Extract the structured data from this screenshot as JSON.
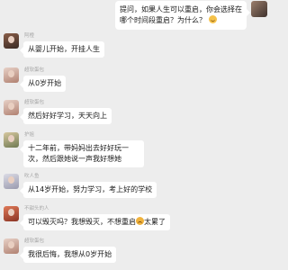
{
  "question": {
    "text": "提问，如果人生可以重启，你会选择在哪个时间段重启？为什么？"
  },
  "messages": [
    {
      "name": "阿橙",
      "text": "从婴儿开始，开挂人生",
      "avatar_color": "#6b4a3a"
    },
    {
      "name": "超软蛋包",
      "text": "从0岁开始",
      "avatar_color": "#c9a99a"
    },
    {
      "name": "超软蛋包",
      "text": "然后好好学习，天天向上",
      "avatar_color": "#c9a99a"
    },
    {
      "name": "护姐",
      "text": "十二年前，带妈妈出去好好玩一次，然后跟她说一声我好想她",
      "avatar_color": "#8a9a6a"
    },
    {
      "name": "吹人鱼",
      "text": "从14岁开始，努力学习，考上好的学校",
      "avatar_color": "#b8b8c8"
    },
    {
      "name": "不甜头的人",
      "text": "可以毁灭吗？我想毁灭，不想重启",
      "text_suffix": "太累了",
      "avatar_color": "#c06048"
    },
    {
      "name": "超软蛋包",
      "text": "我很后悔，我想从0岁开始",
      "avatar_color": "#c9a99a"
    }
  ]
}
